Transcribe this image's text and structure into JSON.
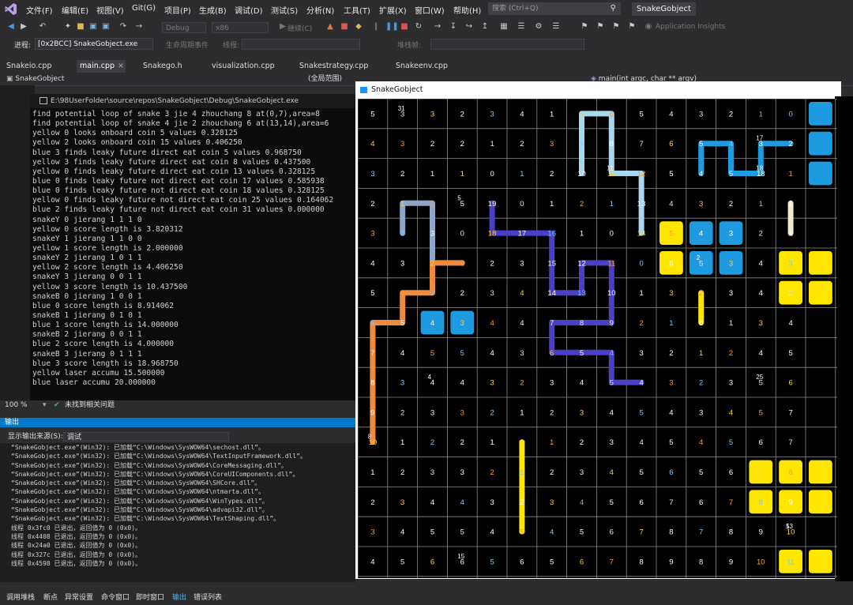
{
  "menubar": {
    "items": [
      "文件(F)",
      "编辑(E)",
      "视图(V)",
      "Git(G)",
      "项目(P)",
      "生成(B)",
      "调试(D)",
      "测试(S)",
      "分析(N)",
      "工具(T)",
      "扩展(X)",
      "窗口(W)",
      "帮助(H)"
    ],
    "search_placeholder": "搜索 (Ctrl+Q)",
    "app_title": "SnakeGobject"
  },
  "toolbar": {
    "config": "Debug",
    "platform": "x86",
    "continue_label": "继续(C)",
    "insights_label": "Application Insights"
  },
  "procbar": {
    "label": "进程:",
    "process": "[0x2BCC] SnakeGobject.exe",
    "lifecycle": "生命周期事件",
    "thread": "线程:",
    "stackframe": "堆栈帧:"
  },
  "tabs": [
    {
      "label": "Snakeio.cpp",
      "active": false
    },
    {
      "label": "main.cpp",
      "active": true
    },
    {
      "label": "Snakego.h",
      "active": false
    },
    {
      "label": "visualization.cpp",
      "active": false
    },
    {
      "label": "Snakestrategy.cpp",
      "active": false
    },
    {
      "label": "Snakeenv.cpp",
      "active": false
    }
  ],
  "navbar": {
    "project": "SnakeGobject",
    "scope": "(全局范围)",
    "function": "main(int argc, char ** argv)"
  },
  "console": {
    "title": "E:\\98UserFolder\\source\\repos\\SnakeGobject\\Debug\\SnakeGobject.exe",
    "lines": [
      "find potential loop of snake 3 jie 4 zhouchang 8 at(0,7),area=8",
      "find potential loop of snake 4 jie 2 zhouchang 6 at(13,14),area=6",
      "yellow 0 looks onboard coin 5 values 0.328125",
      "yellow 2 looks onboard coin 15 values 0.406250",
      "blue 3 finds leaky future direct eat coin 5 values 0.968750",
      "yellow 3 finds leaky future direct eat coin 8 values 0.437500",
      "yellow 0 finds leaky future direct eat coin 13 values 0.328125",
      "blue 0 finds leaky future not direct eat coin 17 values 0.585938",
      "blue 0 finds leaky future not direct eat coin 18 values 0.328125",
      "yellow 0 finds leaky future not direct eat coin 25 values 0.164062",
      "blue 2 finds leaky future not direct eat coin 31 values 0.000000",
      "snakeY 0 jierang 1 1 1 0",
      "yellow 0 score length is 3.820312",
      "snakeY 1 jierang 1 1 0 0",
      "yellow 1 score length is 2.000000",
      "snakeY 2 jierang 1 0 1 1",
      "yellow 2 score length is 4.406250",
      "snakeY 3 jierang 0 0 1 1",
      "yellow 3 score length is 10.437500",
      "snakeB 0 jierang 1 0 0 1",
      "blue 0 score length is 8.914062",
      "snakeB 1 jierang 0 1 0 1",
      "blue 1 score length is 14.000000",
      "snakeB 2 jierang 0 0 1 1",
      "blue 2 score length is 4.000000",
      "snakeB 3 jierang 0 1 1 1",
      "blue 3 score length is 18.968750",
      "yellow laser accumu 15.500000",
      "blue laser accumu 20.000000"
    ]
  },
  "status": {
    "zoom": "100 %",
    "issues": "未找到相关问题"
  },
  "output": {
    "header": "输出",
    "source_label": "显示输出来源(S):",
    "source_value": "调试",
    "lines": [
      "“SnakeGobject.exe”(Win32): 已加载“C:\\Windows\\SysWOW64\\sechost.dll”。",
      "“SnakeGobject.exe”(Win32): 已加载“C:\\Windows\\SysWOW64\\TextInputFramework.dll”。",
      "“SnakeGobject.exe”(Win32): 已加载“C:\\Windows\\SysWOW64\\CoreMessaging.dll”。",
      "“SnakeGobject.exe”(Win32): 已加载“C:\\Windows\\SysWOW64\\CoreUIComponents.dll”。",
      "“SnakeGobject.exe”(Win32): 已加载“C:\\Windows\\SysWOW64\\SHCore.dll”。",
      "“SnakeGobject.exe”(Win32): 已加载“C:\\Windows\\SysWOW64\\ntmarta.dll”。",
      "“SnakeGobject.exe”(Win32): 已加载“C:\\Windows\\SysWOW64\\WinTypes.dll”。",
      "“SnakeGobject.exe”(Win32): 已加载“C:\\Windows\\SysWOW64\\advapi32.dll”。",
      "“SnakeGobject.exe”(Win32): 已加载“C:\\Windows\\SysWOW64\\TextShaping.dll”。",
      "线程 0x3fc0 已退出，返回值为 0 (0x0)。",
      "线程 0x4408 已退出，返回值为 0 (0x0)。",
      "线程 0x24a0 已退出，返回值为 0 (0x0)。",
      "线程 0x327c 已退出，返回值为 0 (0x0)。",
      "线程 0x4598 已退出，返回值为 0 (0x0)。"
    ]
  },
  "bottom_tabs": [
    "调用堆栈",
    "断点",
    "异常设置",
    "命令窗口",
    "即时窗口",
    "输出",
    "错误列表"
  ],
  "game": {
    "title": "SnakeGobject",
    "colors": {
      "blue": "#1e9be0",
      "yellow": "#ffe600",
      "orange": "#f08a3c",
      "purple": "#4b3fc8",
      "lightblue": "#a8d8ee",
      "slate": "#8fa6c9",
      "cream": "#f0ead0",
      "grid": "#8a8a8a"
    },
    "grid": [
      [
        "5",
        "3",
        "3",
        "2",
        "3",
        "4",
        "1",
        "7",
        "6",
        "5",
        "4",
        "3",
        "2",
        "1",
        "0"
      ],
      [
        "4",
        "3",
        "2",
        "2",
        "1",
        "2",
        "3",
        "9",
        "8",
        "7",
        "6",
        "5",
        "4",
        "3",
        "2"
      ],
      [
        "3",
        "2",
        "1",
        "1",
        "0",
        "1",
        "2",
        "10",
        "11",
        "12",
        "5",
        "4",
        "5",
        "18",
        "1"
      ],
      [
        "2",
        "1",
        "0",
        "5",
        "19",
        "0",
        "1",
        "2",
        "1",
        "13",
        "4",
        "3",
        "2",
        "1",
        "1"
      ],
      [
        "3",
        "2",
        "3",
        "0",
        "18",
        "17",
        "16",
        "1",
        "0",
        "14",
        "5",
        "4",
        "3",
        "2",
        "1"
      ],
      [
        "4",
        "3",
        "2",
        "1",
        "2",
        "3",
        "15",
        "12",
        "11",
        "0",
        "6",
        "5",
        "3",
        "4",
        "3"
      ],
      [
        "5",
        "4",
        "3",
        "2",
        "3",
        "4",
        "14",
        "13",
        "10",
        "1",
        "3",
        "2",
        "3",
        "4",
        "2"
      ],
      [
        "6",
        "5",
        "4",
        "3",
        "4",
        "4",
        "7",
        "8",
        "9",
        "2",
        "1",
        "0",
        "1",
        "3",
        "4"
      ],
      [
        "7",
        "4",
        "5",
        "5",
        "4",
        "3",
        "6",
        "5",
        "4",
        "3",
        "2",
        "1",
        "2",
        "4",
        "5"
      ],
      [
        "8",
        "3",
        "4",
        "4",
        "3",
        "2",
        "3",
        "4",
        "5",
        "4",
        "3",
        "2",
        "3",
        "5",
        "6"
      ],
      [
        "9",
        "2",
        "3",
        "3",
        "2",
        "1",
        "2",
        "3",
        "4",
        "5",
        "4",
        "3",
        "4",
        "5",
        "7"
      ],
      [
        "10",
        "1",
        "2",
        "2",
        "1",
        "0",
        "1",
        "2",
        "3",
        "4",
        "5",
        "4",
        "5",
        "6",
        "7"
      ],
      [
        "1",
        "2",
        "3",
        "3",
        "2",
        "1",
        "2",
        "3",
        "4",
        "5",
        "6",
        "5",
        "6",
        "7",
        "8"
      ],
      [
        "2",
        "3",
        "4",
        "4",
        "3",
        "2",
        "3",
        "4",
        "5",
        "6",
        "7",
        "6",
        "7",
        "8",
        "9"
      ],
      [
        "3",
        "4",
        "5",
        "5",
        "4",
        "5",
        "4",
        "5",
        "6",
        "7",
        "8",
        "7",
        "8",
        "9",
        "10"
      ],
      [
        "4",
        "5",
        "6",
        "6",
        "5",
        "6",
        "5",
        "6",
        "7",
        "8",
        "9",
        "8",
        "9",
        "10",
        "11"
      ]
    ],
    "labels": [
      "31",
      "5",
      "4",
      "25",
      "15",
      "5",
      "13",
      "17",
      "18",
      "11",
      "2",
      "8"
    ],
    "snake_numbers": [
      "0",
      "0",
      "1",
      "3",
      "0",
      "2",
      "1",
      "0",
      "0",
      "1",
      "2",
      "3",
      "0",
      "0",
      "0",
      "0",
      "0",
      "0",
      "0"
    ]
  }
}
